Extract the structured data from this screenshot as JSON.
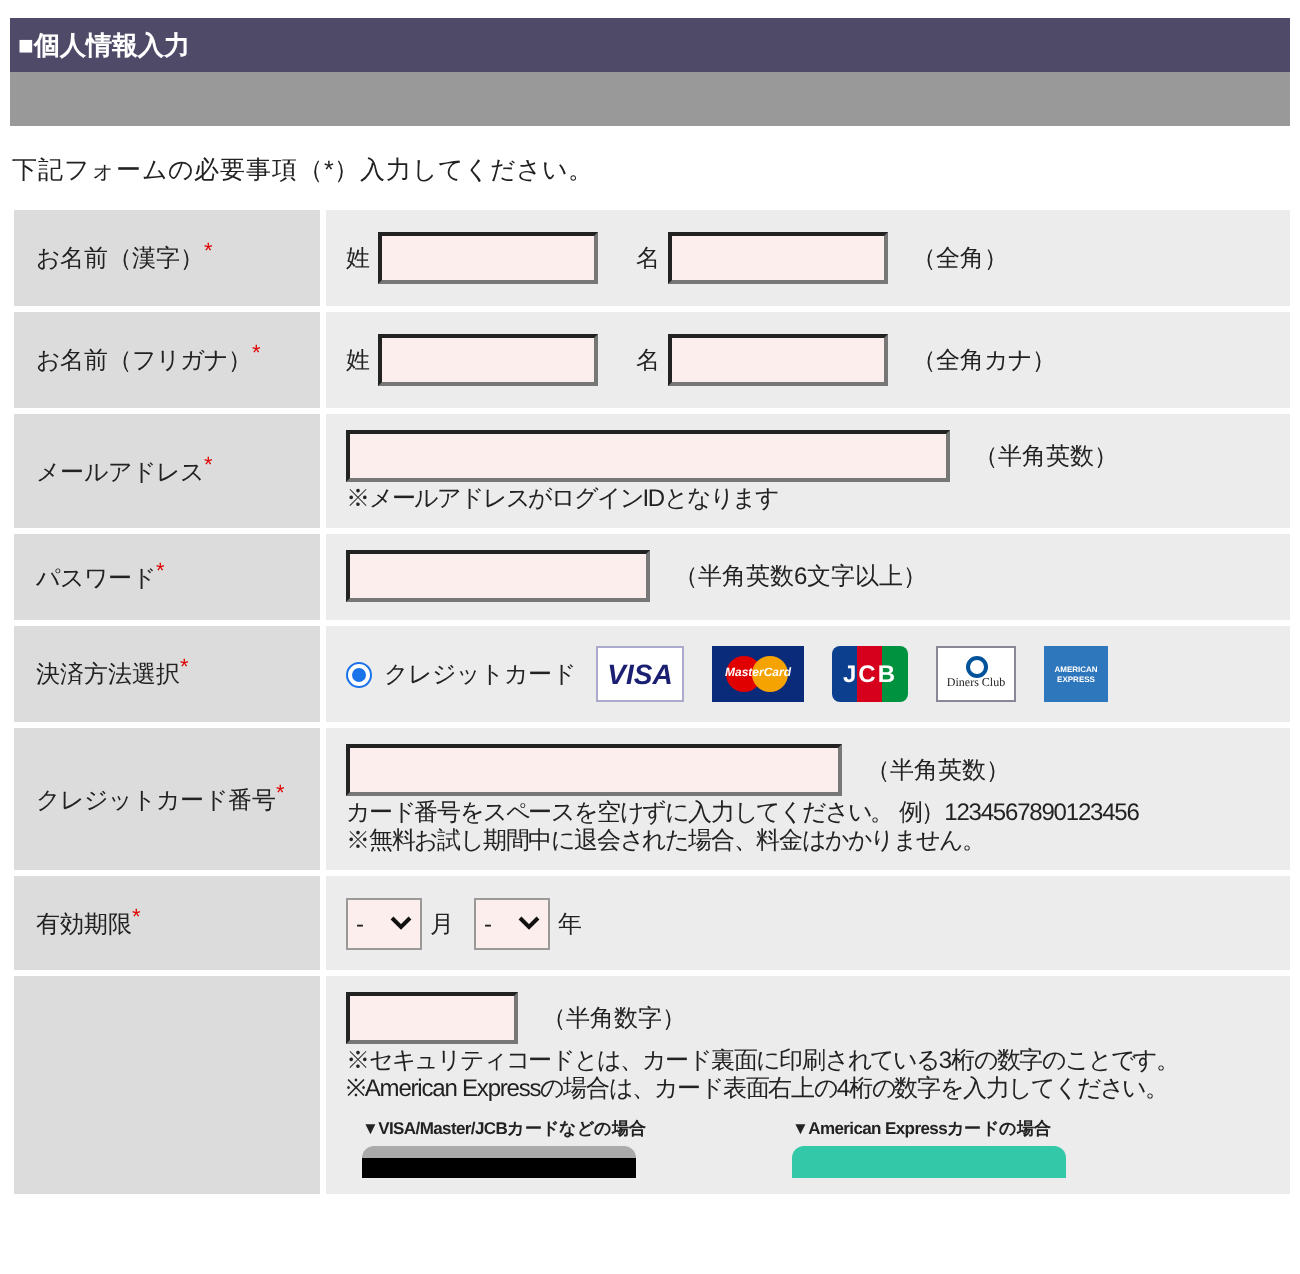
{
  "section_title": "■個人情報入力",
  "intro": "下記フォームの必要事項（*）入力してください。",
  "rows": [
    {
      "kind": "name_pair",
      "label": "お名前（漢字）",
      "required_mark": "*",
      "fields": [
        {
          "prefix": "姓"
        },
        {
          "prefix": "名"
        }
      ],
      "note": "（全角）"
    },
    {
      "kind": "name_pair",
      "label": "お名前（フリガナ）",
      "required_mark": "*",
      "fields": [
        {
          "prefix": "姓"
        },
        {
          "prefix": "名"
        }
      ],
      "note": "（全角カナ）"
    },
    {
      "kind": "email",
      "label": "メールアドレス",
      "required_mark": "*",
      "note": "（半角英数）",
      "hints": [
        "※メールアドレスがログインIDとなります"
      ]
    },
    {
      "kind": "password",
      "label": "パスワード",
      "required_mark": "*",
      "note": "（半角英数6文字以上）"
    },
    {
      "kind": "payment",
      "label": "決済方法選択",
      "required_mark": "*",
      "options": [
        {
          "label": "クレジットカード",
          "selected": true
        }
      ],
      "logos": [
        {
          "kind": "visa",
          "text": "VISA"
        },
        {
          "kind": "master",
          "text": "MasterCard"
        },
        {
          "kind": "jcb",
          "text": "JCB"
        },
        {
          "kind": "diners",
          "text": "Diners Club"
        },
        {
          "kind": "amex",
          "text": "AMERICAN EXPRESS"
        }
      ]
    },
    {
      "kind": "card_number",
      "label": "クレジットカード番号",
      "required_mark": "*",
      "note": "（半角英数）",
      "hints": [
        "カード番号をスペースを空けずに入力してください。 例）1234567890123456",
        "※無料お試し期間中に退会された場合、料金はかかりません。"
      ]
    },
    {
      "kind": "selects",
      "label": "有効期限",
      "required_mark": "*",
      "selects": [
        {
          "value": "-",
          "unit": "月"
        },
        {
          "value": "-",
          "unit": "年"
        }
      ]
    },
    {
      "kind": "security",
      "note": "（半角数字）",
      "hints": [
        "※セキュリティコードとは、カード裏面に印刷されている3桁の数字のことです。",
        "※American Expressの場合は、カード表面右上の4桁の数字を入力してください。"
      ],
      "examples": [
        {
          "kind": "back",
          "caption": "▼VISA/Master/JCBカードなどの場合"
        },
        {
          "kind": "front",
          "caption": "▼American Expressカードの場合"
        }
      ]
    }
  ]
}
